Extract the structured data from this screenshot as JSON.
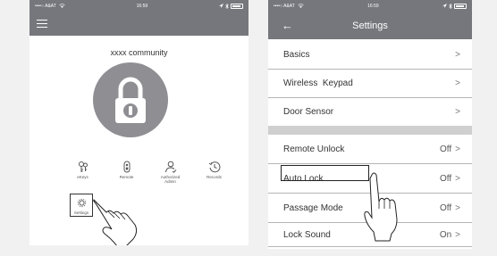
{
  "left_screen": {
    "status": {
      "carrier": "••••○ A&AT",
      "time": "16:59"
    },
    "community_name": "xxxx community",
    "features": [
      {
        "label": "eKeys",
        "icon": "ekeys-icon"
      },
      {
        "label": "Remote",
        "icon": "remote-icon"
      },
      {
        "label": "Authorized Admin",
        "icon": "authorized-admin-icon"
      },
      {
        "label": "Records",
        "icon": "records-icon"
      }
    ],
    "settings_label": "Settings",
    "colors": {
      "header": "#76777c",
      "lock": "#8e8e93"
    }
  },
  "right_screen": {
    "status": {
      "carrier": "••••○ A&AT",
      "time": "16:59"
    },
    "title": "Settings",
    "back_icon": "back-arrow-icon",
    "items": [
      {
        "label": "Basics",
        "value": ""
      },
      {
        "label": "Wireless  Keypad",
        "value": ""
      },
      {
        "label": "Door Sensor",
        "value": ""
      },
      {
        "label": "Remote Unlock",
        "value": "Off"
      },
      {
        "label": "Auto Lock",
        "value": "Off"
      },
      {
        "label": "Passage Mode",
        "value": "Off"
      },
      {
        "label": "Lock Sound",
        "value": "On"
      }
    ],
    "chevron": ">"
  }
}
